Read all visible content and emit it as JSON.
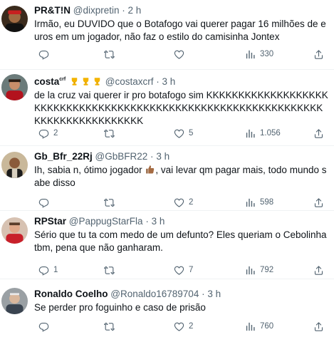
{
  "tweets": [
    {
      "name": "PR&T!N",
      "handle": "@dixpretin",
      "time": "2 h",
      "text": "Irmão, eu DUVIDO que o Botafogo vai querer pagar 16 milhões de euros em um jogador, não faz o estilo do camisinha Jontex",
      "replies": "",
      "retweets": "",
      "likes": "",
      "views": "330"
    },
    {
      "name": "costa",
      "name_sup": "crf",
      "handle": "@costaxcrf",
      "time": "3 h",
      "text": "de la cruz vai querer ir pro botafogo sim KKKKKKKKKKKKKKKKKKKKKKKKKKKKKKKKKKKKKKKKKKKKKKKKKKKKKKKKKKKKKKKKKKKKKKKKKKKKKKKKK",
      "replies": "2",
      "retweets": "",
      "likes": "5",
      "views": "1.056"
    },
    {
      "name": "Gb_Bfr_22Rj",
      "handle": "@GbBFR22",
      "time": "3 h",
      "text_before": "Ih, sabia n, ótimo jogador",
      "text_after": ", vai levar qm pagar mais, todo mundo sabe disso",
      "replies": "",
      "retweets": "",
      "likes": "2",
      "views": "598"
    },
    {
      "name": "RPStar",
      "handle": "@PappugStarFla",
      "time": "3 h",
      "text": "Sério que tu ta com medo de um defunto? Eles queriam o Cebolinha tbm, pena que não ganharam.",
      "replies": "1",
      "retweets": "",
      "likes": "7",
      "views": "792"
    },
    {
      "name": "Ronaldo Coelho",
      "handle": "@Ronaldo16789704",
      "time": "3 h",
      "text": "Se perder pro foguinho e caso de prisão",
      "replies": "",
      "retweets": "",
      "likes": "2",
      "views": "760"
    }
  ],
  "separator": "·",
  "icons": {
    "reply": "reply-icon",
    "retweet": "retweet-icon",
    "like": "heart-icon",
    "views": "views-chart-icon",
    "share": "share-icon"
  },
  "colors": {
    "text": "#0f1419",
    "muted": "#536471",
    "divider": "#eff3f4"
  }
}
